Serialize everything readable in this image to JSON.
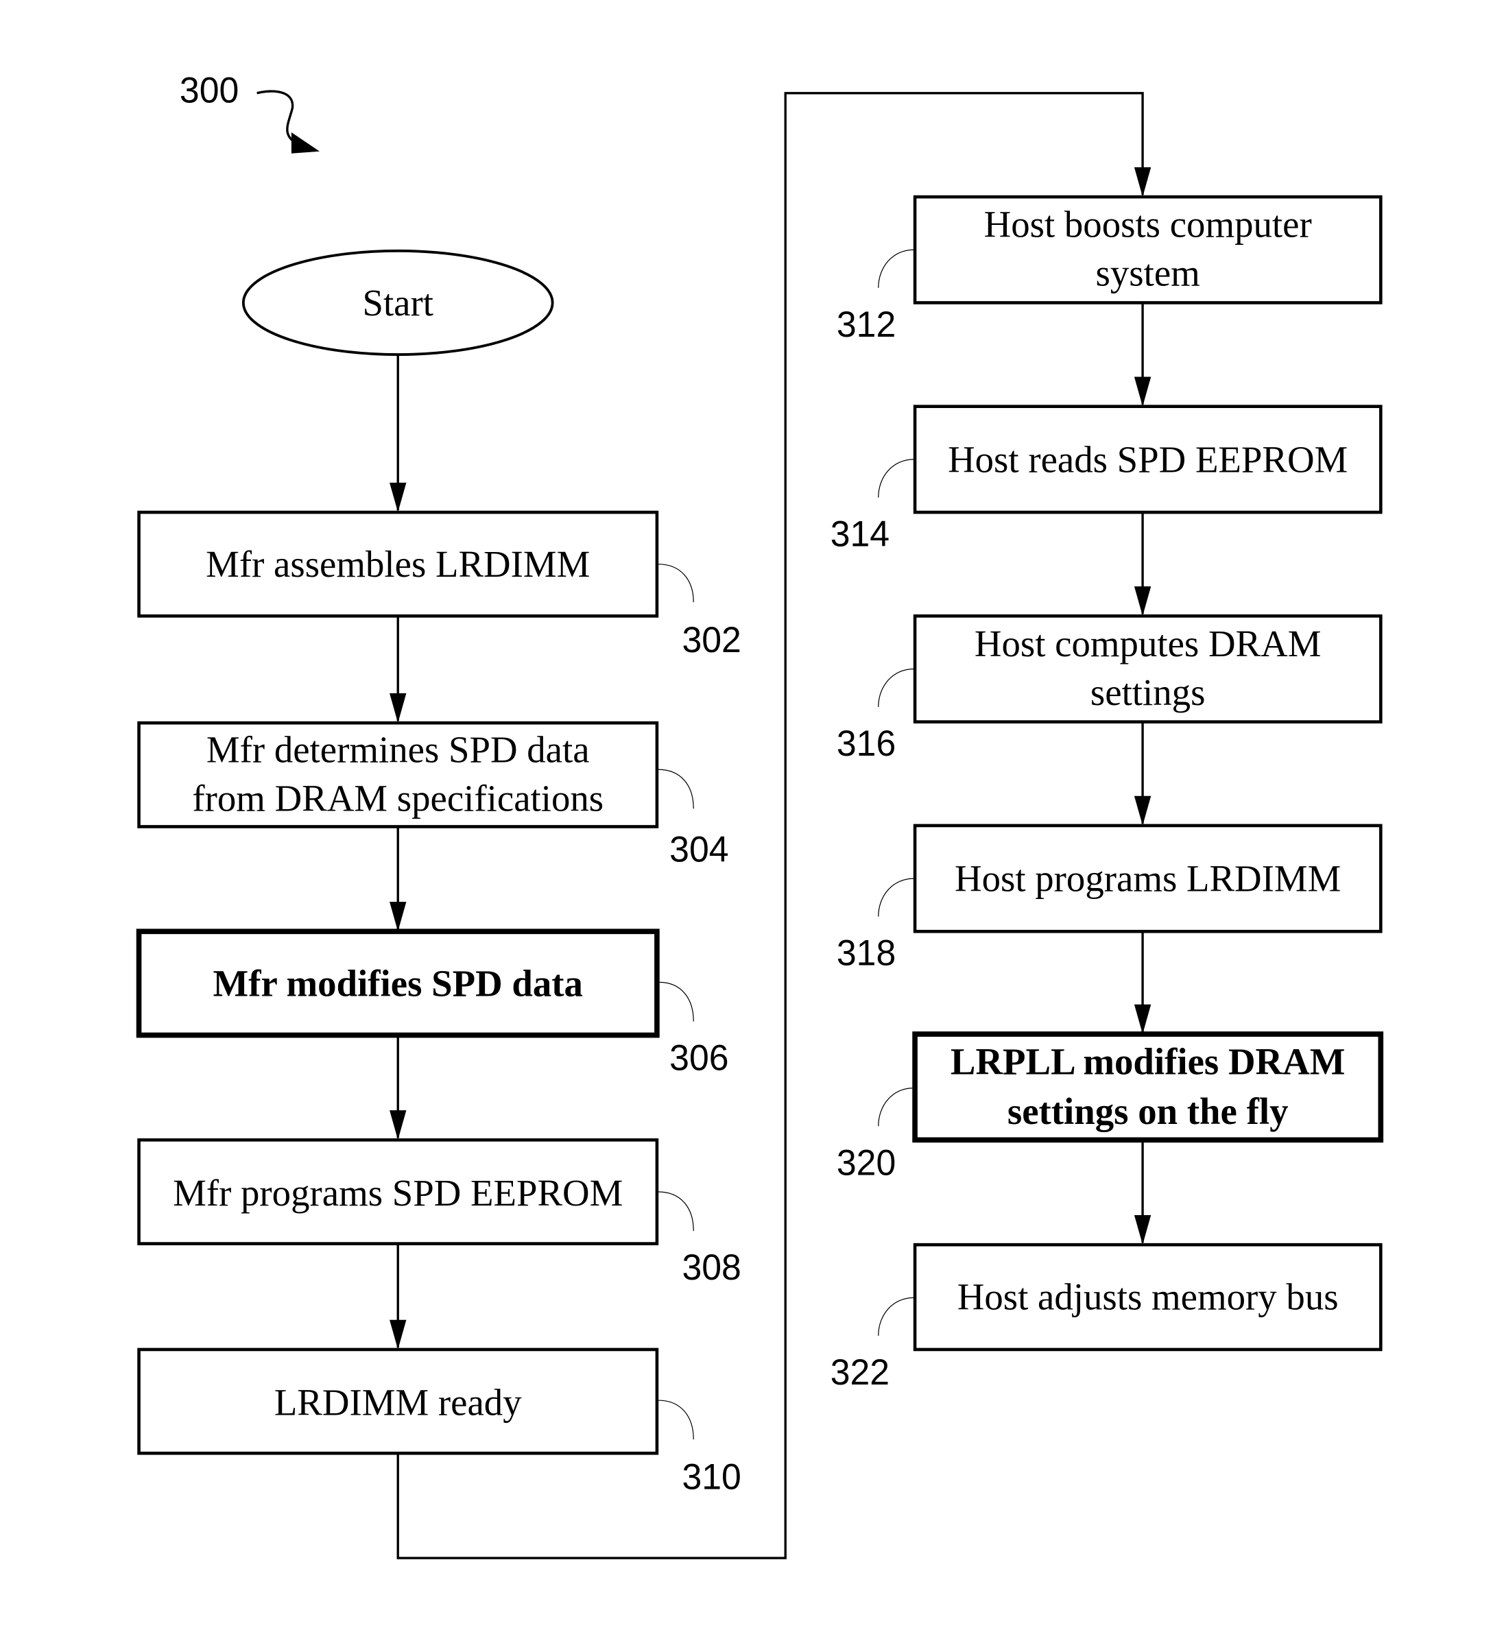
{
  "figure": {
    "number": "300",
    "start_label": "Start"
  },
  "left_column": [
    {
      "ref": "302",
      "lines": [
        "Mfr assembles LRDIMM"
      ],
      "emphasis": false
    },
    {
      "ref": "304",
      "lines": [
        "Mfr determines SPD data",
        "from DRAM specifications"
      ],
      "emphasis": false
    },
    {
      "ref": "306",
      "lines": [
        "Mfr modifies SPD data"
      ],
      "emphasis": true
    },
    {
      "ref": "308",
      "lines": [
        "Mfr programs SPD EEPROM"
      ],
      "emphasis": false
    },
    {
      "ref": "310",
      "lines": [
        "LRDIMM ready"
      ],
      "emphasis": false
    }
  ],
  "right_column": [
    {
      "ref": "312",
      "lines": [
        "Host boosts computer",
        "system"
      ],
      "emphasis": false
    },
    {
      "ref": "314",
      "lines": [
        "Host reads SPD EEPROM"
      ],
      "emphasis": false
    },
    {
      "ref": "316",
      "lines": [
        "Host computes DRAM",
        "settings"
      ],
      "emphasis": false
    },
    {
      "ref": "318",
      "lines": [
        "Host programs LRDIMM"
      ],
      "emphasis": false
    },
    {
      "ref": "320",
      "lines": [
        "LRPLL modifies DRAM",
        "settings on the fly"
      ],
      "emphasis": true
    },
    {
      "ref": "322",
      "lines": [
        "Host adjusts memory bus"
      ],
      "emphasis": false
    }
  ]
}
